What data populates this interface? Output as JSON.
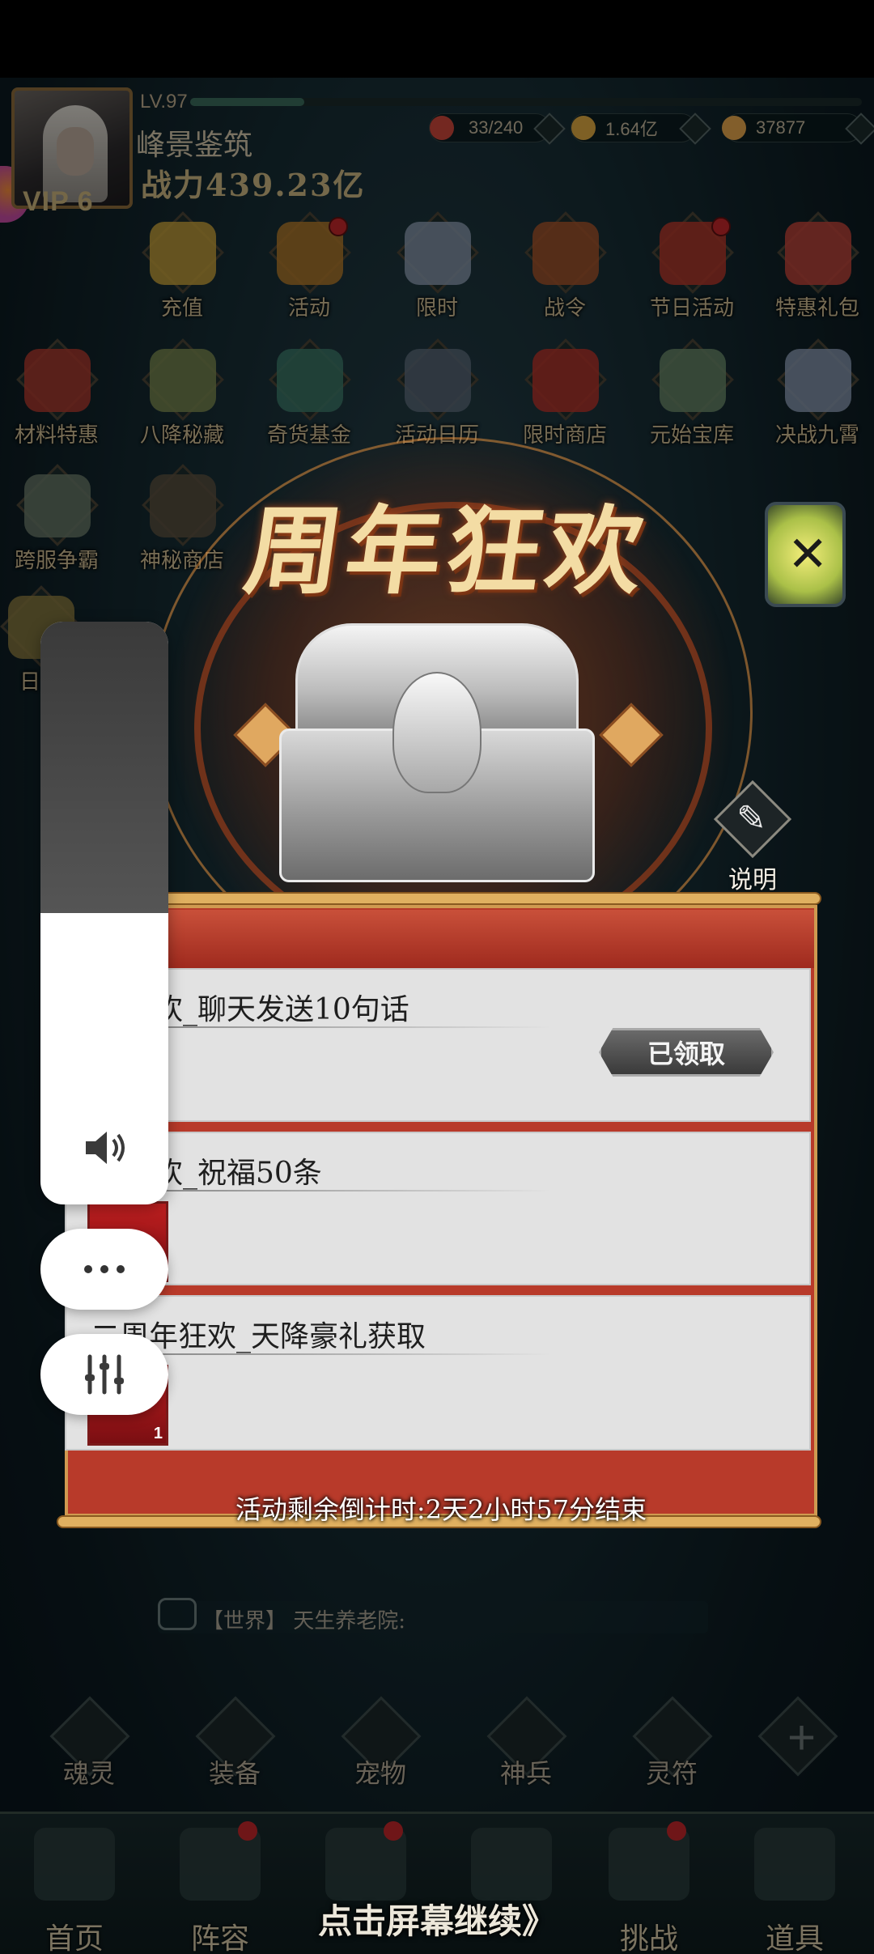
{
  "header": {
    "level": "LV.97",
    "exp_fraction": 0.17,
    "player_name": "峰景鉴筑",
    "power": "战力439.23亿",
    "vip": "VIP 6",
    "resources": [
      {
        "icon": "stamina-icon",
        "value": "33/240",
        "color": "#c8453a"
      },
      {
        "icon": "gold-coin-icon",
        "value": "1.64亿",
        "color": "#d9a641"
      },
      {
        "icon": "gem-icon",
        "value": "37877",
        "color": "#e0a24a"
      }
    ]
  },
  "grid": {
    "row1": [
      "充值",
      "活动",
      "限时",
      "战令",
      "节日活动",
      "特惠礼包"
    ],
    "row2": [
      "材料特惠",
      "八降秘藏",
      "奇货基金",
      "活动日历",
      "限时商店",
      "元始宝库",
      "决战九霄"
    ],
    "row3": [
      "跨服争霸",
      "神秘商店"
    ],
    "row4": [
      "日常"
    ]
  },
  "modal": {
    "title": "周年狂欢",
    "help_label": "说明",
    "tasks": [
      {
        "title": "年狂欢_聊天发送10句话",
        "reward_count": "",
        "button": "已领取"
      },
      {
        "title": "年狂欢_祝福50条",
        "reward_count": ""
      },
      {
        "title": "二周年狂欢_天降豪礼获取",
        "reward_count": "1"
      }
    ],
    "countdown": "活动剩余倒计时:2天2小时57分结束"
  },
  "chat": {
    "channel": "【世界】",
    "text": "天生养老院:"
  },
  "bottom_row": [
    "魂灵",
    "装备",
    "宠物",
    "神兵",
    "灵符",
    ""
  ],
  "nav": [
    "首页",
    "阵容",
    "",
    "",
    "挑战",
    "道具"
  ],
  "tap_continue": "点击屏幕继续》",
  "volume": {
    "level": 0.5
  },
  "colors": {
    "panel_red": "#b83a2a",
    "gold_rail": "#e0b060",
    "title_gold": "#f3dca4",
    "card_gray": "#e2e2e2",
    "badge_red": "#c0262a"
  }
}
